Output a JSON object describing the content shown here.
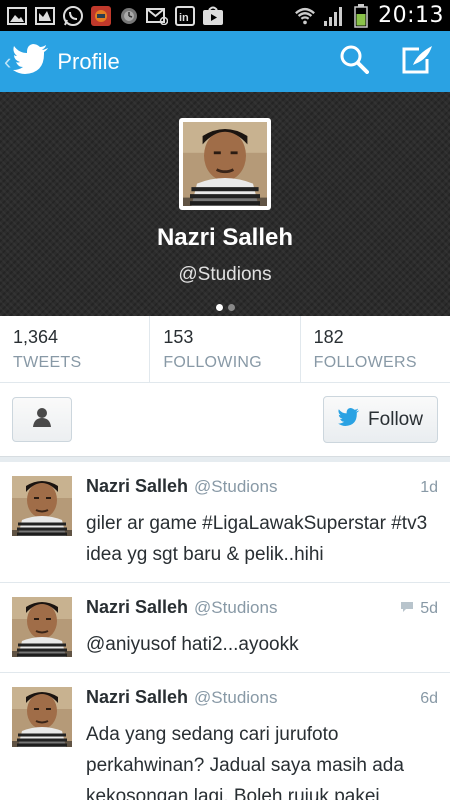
{
  "status_bar": {
    "time": "20:13",
    "icons": [
      "gallery-icon",
      "photo-icon",
      "whatsapp-icon",
      "game-app-icon",
      "clock-app-icon",
      "email-icon",
      "linkedin-icon",
      "play-store-icon",
      "wifi-icon",
      "signal-icon",
      "battery-icon"
    ]
  },
  "action_bar": {
    "title": "Profile",
    "back_icon": "chevron-left-icon",
    "logo_icon": "twitter-bird-icon",
    "actions": [
      "search-icon",
      "compose-icon"
    ]
  },
  "profile": {
    "name": "Nazri Salleh",
    "handle": "@Studions",
    "page_count": 2,
    "active_page": 1
  },
  "stats": [
    {
      "value": "1,364",
      "label": "TWEETS"
    },
    {
      "value": "153",
      "label": "FOLLOWING"
    },
    {
      "value": "182",
      "label": "FOLLOWERS"
    }
  ],
  "actions": {
    "user_menu_icon": "person-icon",
    "follow_label": "Follow"
  },
  "tweets": [
    {
      "name": "Nazri Salleh",
      "handle": "@Studions",
      "time": "1d",
      "text": "giler ar game #LigaLawakSuperstar #tv3 idea yg sgt baru & pelik..hihi",
      "has_conversation": false
    },
    {
      "name": "Nazri Salleh",
      "handle": "@Studions",
      "time": "5d",
      "text": "@aniyusof hati2...ayookk",
      "has_conversation": true
    },
    {
      "name": "Nazri Salleh",
      "handle": "@Studions",
      "time": "6d",
      "text": "Ada yang sedang cari jurufoto perkahwinan? Jadual saya masih ada kekosongan lagi. Boleh rujuk pakej",
      "has_conversation": false
    }
  ],
  "colors": {
    "twitter_blue": "#2aa2e3",
    "header_bg": "#2c2c2c",
    "muted_text": "#8899a6",
    "battery_green": "#8bc34a"
  }
}
